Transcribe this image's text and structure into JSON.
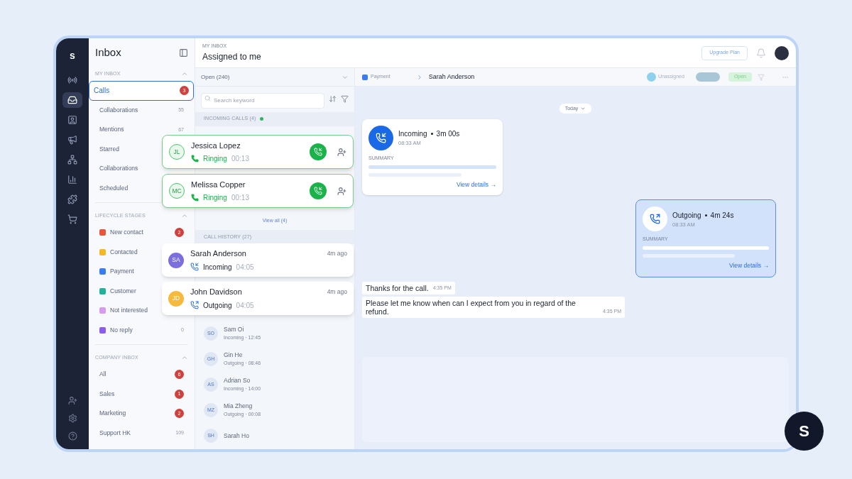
{
  "rail": {
    "logo": "s",
    "items": [
      {
        "kind": "broadcast",
        "selected": false
      },
      {
        "kind": "inbox",
        "selected": true
      },
      {
        "kind": "contacts",
        "selected": false
      },
      {
        "kind": "megaphone",
        "selected": false
      },
      {
        "kind": "workflow",
        "selected": false
      },
      {
        "kind": "reports",
        "selected": false
      },
      {
        "kind": "integrations",
        "selected": false
      },
      {
        "kind": "store",
        "selected": false
      }
    ],
    "bottom": [
      {
        "kind": "add-user"
      },
      {
        "kind": "settings"
      },
      {
        "kind": "help"
      }
    ]
  },
  "sidebar": {
    "title": "Inbox",
    "sections": [
      {
        "title": "MY INBOX",
        "expanded": true,
        "items": [
          {
            "label": "Calls",
            "count": "3",
            "alert": true,
            "selected": true
          },
          {
            "label": "Collaborations",
            "count": "55",
            "alert": false,
            "selected": false
          },
          {
            "label": "Mentions",
            "count": "67",
            "alert": false,
            "selected": false
          },
          {
            "label": "Starred",
            "selected": false
          },
          {
            "label": "Collaborations",
            "selected": false
          },
          {
            "label": "Scheduled",
            "selected": false
          }
        ]
      },
      {
        "title": "LIFECYCLE STAGES",
        "expanded": true,
        "items": [
          {
            "label": "New contact",
            "color": "#e8553a",
            "count": "2",
            "alert": true,
            "selected": false
          },
          {
            "label": "Contacted",
            "color": "#f5b823",
            "selected": false
          },
          {
            "label": "Payment",
            "color": "#3b7cf0",
            "selected": false
          },
          {
            "label": "Customer",
            "color": "#22b29a",
            "selected": false
          },
          {
            "label": "Not interested",
            "color": "#d79af0",
            "selected": false
          },
          {
            "label": "No reply",
            "color": "#8a5cf0",
            "count": "0",
            "alert": false,
            "selected": false
          }
        ]
      },
      {
        "title": "COMPANY INBOX",
        "expanded": true,
        "items": [
          {
            "label": "All",
            "count": "6",
            "alert": true,
            "selected": false
          },
          {
            "label": "Sales",
            "count": "1",
            "alert": true,
            "selected": false
          },
          {
            "label": "Marketing",
            "count": "2",
            "alert": true,
            "selected": false
          },
          {
            "label": "Support HK",
            "count": "109",
            "alert": false,
            "selected": false
          }
        ]
      }
    ]
  },
  "header": {
    "eyebrow": "MY INBOX",
    "title": "Assigned to me",
    "upgrade_button": "Upgrade Plan"
  },
  "list": {
    "filter": "Open (240)",
    "search": {
      "placeholder": "Search keyword"
    },
    "incoming_header": "INCOMING CALLS (4)",
    "view_all": "View all (4)",
    "history_header": "CALL HISTORY (27)",
    "history_rows": [
      {
        "initials": "SO",
        "name": "Sam Oi",
        "detail": "Incoming · 12:45"
      },
      {
        "initials": "GH",
        "name": "Gin He",
        "detail": "Outgoing · 08:46"
      },
      {
        "initials": "AS",
        "name": "Adrian So",
        "detail": "Incoming · 14:00"
      },
      {
        "initials": "MZ",
        "name": "Mia Zheng",
        "detail": "Outgoing · 00:08"
      },
      {
        "initials": "SH",
        "name": "Sarah Ho"
      }
    ]
  },
  "ringing_calls": [
    {
      "initials": "JL",
      "name": "Jessica Lopez",
      "status": "Ringing",
      "duration": "00:13"
    },
    {
      "initials": "MC",
      "name": "Melissa Copper",
      "status": "Ringing",
      "duration": "00:13"
    }
  ],
  "recent_calls": [
    {
      "initials": "SA",
      "name": "Sarah Anderson",
      "kind": "incoming",
      "label": "Incoming",
      "duration": "04:05",
      "time": "4m ago",
      "color": "#7b6fe0"
    },
    {
      "initials": "JD",
      "name": "John Davidson",
      "kind": "outgoing",
      "label": "Outgoing",
      "duration": "04:05",
      "time": "4m ago",
      "color": "#f6b93b"
    }
  ],
  "conversation": {
    "tag": {
      "label": "Payment",
      "color": "#3b7cf0"
    },
    "contact": "Sarah Anderson",
    "assignee": "Unassigned",
    "status": "Open",
    "date_chip": "Today",
    "call_cards": [
      {
        "kind": "incoming",
        "label": "Incoming",
        "duration": "3m 00s",
        "time": "08:33 AM",
        "summary_label": "SUMMARY",
        "link": "View details →",
        "selected": false
      },
      {
        "kind": "outgoing",
        "label": "Outgoing",
        "duration": "4m 24s",
        "time": "08:33 AM",
        "summary_label": "SUMMARY",
        "link": "View details →",
        "selected": true
      }
    ],
    "messages": [
      {
        "text": "Thanks for the call.",
        "time": "4:35 PM"
      },
      {
        "text": "Please let me know when can I expect from you in regard of the refund.",
        "time": "4:35 PM"
      }
    ]
  },
  "brand_badge": "S"
}
